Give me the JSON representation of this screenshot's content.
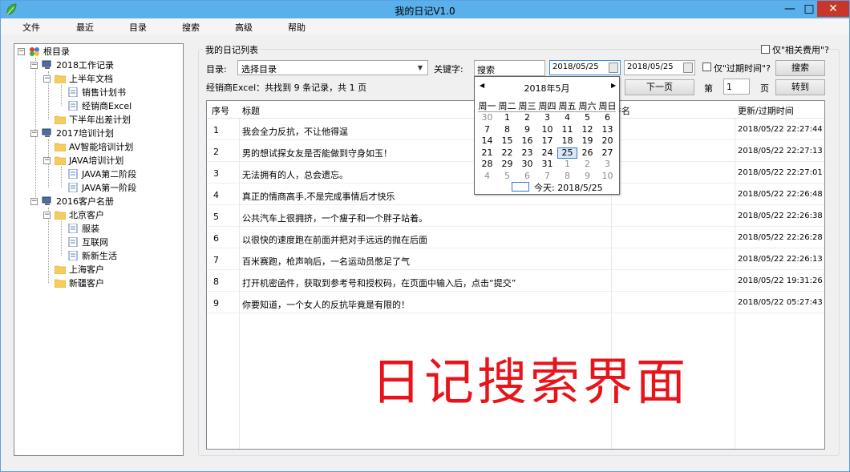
{
  "window": {
    "title": "我的日记V1.0",
    "minimize": "—",
    "maximize": "□",
    "close": "✕"
  },
  "menu": [
    "文件",
    "最近",
    "目录",
    "搜索",
    "高级",
    "帮助"
  ],
  "tree": {
    "items": [
      {
        "label": "根目录",
        "icon": "root-colorful-icon"
      },
      {
        "label": "2018工作记录",
        "icon": "computer-icon"
      },
      {
        "label": "上半年文档",
        "icon": "folder-icon"
      },
      {
        "label": "销售计划书",
        "icon": "document-icon"
      },
      {
        "label": "经销商Excel",
        "icon": "document-icon"
      },
      {
        "label": "下半年出差计划",
        "icon": "folder-icon"
      },
      {
        "label": "2017培训计划",
        "icon": "computer-icon"
      },
      {
        "label": "AV智能培训计划",
        "icon": "folder-icon"
      },
      {
        "label": "JAVA培训计划",
        "icon": "folder-icon"
      },
      {
        "label": "JAVA第二阶段",
        "icon": "document-icon"
      },
      {
        "label": "JAVA第一阶段",
        "icon": "document-icon"
      },
      {
        "label": "2016客户名册",
        "icon": "computer-icon"
      },
      {
        "label": "北京客户",
        "icon": "folder-icon"
      },
      {
        "label": "服装",
        "icon": "document-icon"
      },
      {
        "label": "互联网",
        "icon": "document-icon"
      },
      {
        "label": "新新生活",
        "icon": "document-icon"
      },
      {
        "label": "上海客户",
        "icon": "folder-icon"
      },
      {
        "label": "新疆客户",
        "icon": "folder-icon"
      }
    ]
  },
  "search": {
    "group_title": "我的日记列表",
    "catalog_label": "目录:",
    "catalog_value": "选择目录",
    "keyword_label": "关键字:",
    "keyword_value": "搜索",
    "date_from": "2018/05/25",
    "date_to": "2018/05/25",
    "expiry_checkbox_label": "仅\"过期时间\"?",
    "fee_checkbox_label": "仅\"相关费用\"?",
    "search_button": "搜索",
    "result_text": "经销商Excel：共找到 9 条记录，共 1 页",
    "next_page_button": "下一页",
    "page_prefix": "第",
    "page_value": "1",
    "page_suffix": "页",
    "goto_button": "转到"
  },
  "table": {
    "headers": [
      "序号",
      "标题",
      "件名",
      "更新/过期时间"
    ],
    "rows": [
      {
        "no": "1",
        "title": "我会全力反抗，不让他得逞",
        "time": "2018/05/22 22:27:44"
      },
      {
        "no": "2",
        "title": "男的想试探女友是否能做到守身如玉！",
        "time": "2018/05/22 22:27:13"
      },
      {
        "no": "3",
        "title": "无法拥有的人，总会遗忘。",
        "time": "2018/05/22 22:27:01"
      },
      {
        "no": "4",
        "title": "真正的情商高手,不是完成事情后才快乐",
        "time": "2018/05/22 22:26:48"
      },
      {
        "no": "5",
        "title": "公共汽车上很拥挤，一个瘦子和一个胖子站着。",
        "time": "2018/05/22 22:26:38"
      },
      {
        "no": "6",
        "title": "以很快的速度跑在前面并把对手远远的抛在后面",
        "time": "2018/05/22 22:26:28"
      },
      {
        "no": "7",
        "title": "百米赛跑，枪声响后，一名运动员憋足了气",
        "time": "2018/05/22 22:26:13"
      },
      {
        "no": "8",
        "title": "打开机密函件，获取到参考号和授权码，在页面中输入后，点击“提交”",
        "time": "2018/05/22 19:31:26"
      },
      {
        "no": "9",
        "title": "你要知道，一个女人的反抗毕竟是有限的！",
        "time": "2018/05/22 05:27:43"
      }
    ]
  },
  "calendar": {
    "month_title": "2018年5月",
    "prev": "◀",
    "next": "▶",
    "weekdays": [
      "周一",
      "周二",
      "周三",
      "周四",
      "周五",
      "周六",
      "周日"
    ],
    "weeks": [
      [
        "30",
        "1",
        "2",
        "3",
        "4",
        "5",
        "6"
      ],
      [
        "7",
        "8",
        "9",
        "10",
        "11",
        "12",
        "13"
      ],
      [
        "14",
        "15",
        "16",
        "17",
        "18",
        "19",
        "20"
      ],
      [
        "21",
        "22",
        "23",
        "24",
        "25",
        "26",
        "27"
      ],
      [
        "28",
        "29",
        "30",
        "31",
        "1",
        "2",
        "3"
      ],
      [
        "4",
        "5",
        "6",
        "7",
        "8",
        "9",
        "10"
      ]
    ],
    "selected_day": "25",
    "today_label": "今天: 2018/5/25"
  },
  "overlay_caption": "日记搜索界面",
  "colors": {
    "titlebar": "#5ab0ea",
    "overlay": "#e8141b",
    "close_button": "#c8362b",
    "folder": "#f6cd5b"
  }
}
